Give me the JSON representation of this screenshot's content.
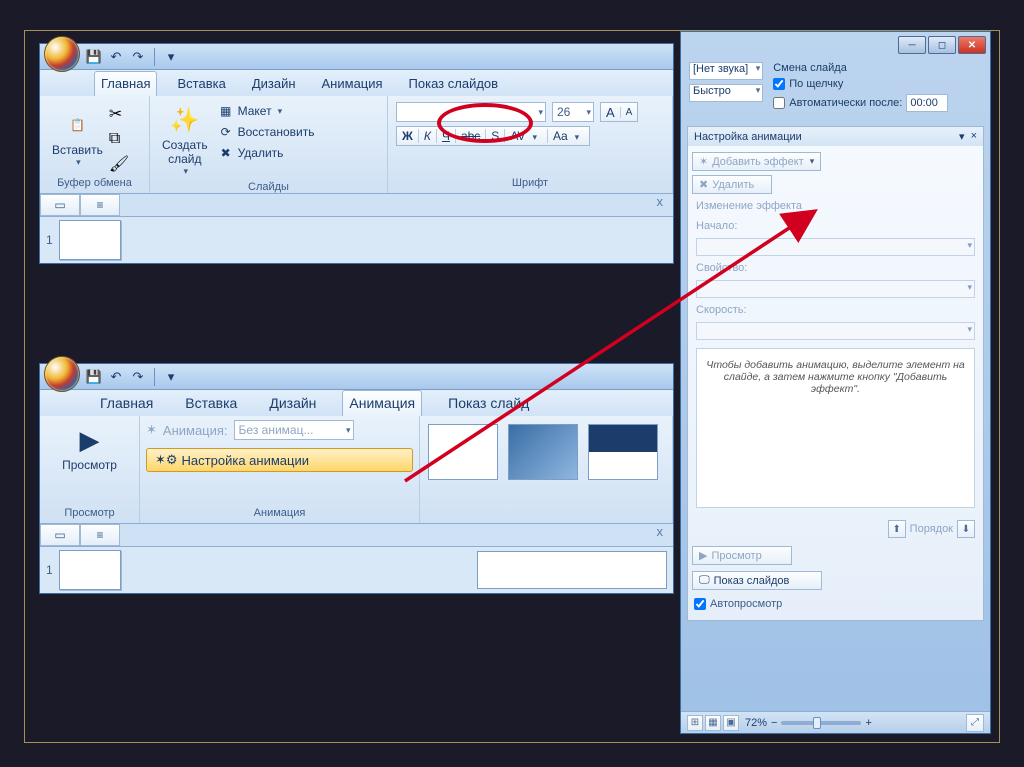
{
  "win1": {
    "tabs": [
      "Главная",
      "Вставка",
      "Дизайн",
      "Анимация",
      "Показ слайдов"
    ],
    "active_tab_index": 0,
    "circled_tab_index": 3,
    "clipboard": {
      "paste": "Вставить",
      "group": "Буфер обмена"
    },
    "slides": {
      "new": "Создать\nслайд",
      "layout": "Макет",
      "reset": "Восстановить",
      "delete": "Удалить",
      "group": "Слайды"
    },
    "font": {
      "size": "26",
      "group": "Шрифт"
    },
    "slide_number": "1"
  },
  "win2": {
    "tabs": [
      "Главная",
      "Вставка",
      "Дизайн",
      "Анимация",
      "Показ слайд"
    ],
    "active_tab_index": 3,
    "preview": "Просмотр",
    "preview_group": "Просмотр",
    "anim_label": "Анимация:",
    "anim_combo": "Без анимац...",
    "custom_anim": "Настройка анимации",
    "animation_group": "Анимация",
    "slide_number": "1"
  },
  "win3": {
    "sound_combo": "[Нет звука]",
    "speed_combo": "Быстро",
    "transition_title": "Смена слайда",
    "on_click": "По щелчку",
    "auto_after": "Автоматически после:",
    "auto_time": "00:00",
    "pane_title": "Настройка анимации",
    "add_effect": "Добавить эффект",
    "remove": "Удалить",
    "modify": "Изменение эффекта",
    "start": "Начало:",
    "property": "Свойство:",
    "speed": "Скорость:",
    "hint": "Чтобы добавить анимацию, выделите элемент на слайде, а затем нажмите кнопку \"Добавить эффект\".",
    "order": "Порядок",
    "play": "Просмотр",
    "slideshow": "Показ слайдов",
    "autopreview": "Автопросмотр",
    "zoom": "72%"
  }
}
